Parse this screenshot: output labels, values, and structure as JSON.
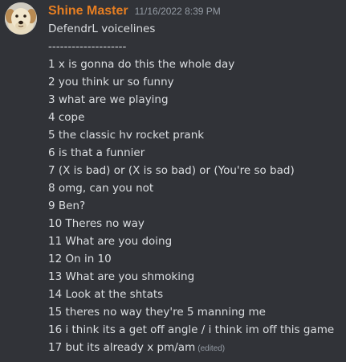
{
  "message": {
    "username": "Shine Master",
    "timestamp": "11/16/2022 8:39 PM",
    "username_color": "#e67e22",
    "lines": [
      "DefendrL voicelines",
      "--------------------",
      "1 x is gonna do this the whole day",
      "2 you think ur so funny",
      "3 what are we playing",
      "4 cope",
      "5 the classic hv rocket prank",
      "6 is that a funnier",
      "7 (X is bad) or (X is so bad) or (You're so bad)",
      "8 omg, can you not",
      "9 Ben?",
      "10 Theres no way",
      "11 What are you doing",
      "12 On in 10",
      "13 What are you shmoking",
      "14 Look at the shtats",
      "15 theres no way they're 5 manning me",
      "16 i think its a get off angle / i think im off this game",
      "17 but its already x pm/am"
    ],
    "edited_label": "(edited)"
  },
  "theme": {
    "background": "#313338",
    "text": "#dbdee1",
    "muted": "#949ba4"
  },
  "avatar_icon": "dog-avatar-icon"
}
